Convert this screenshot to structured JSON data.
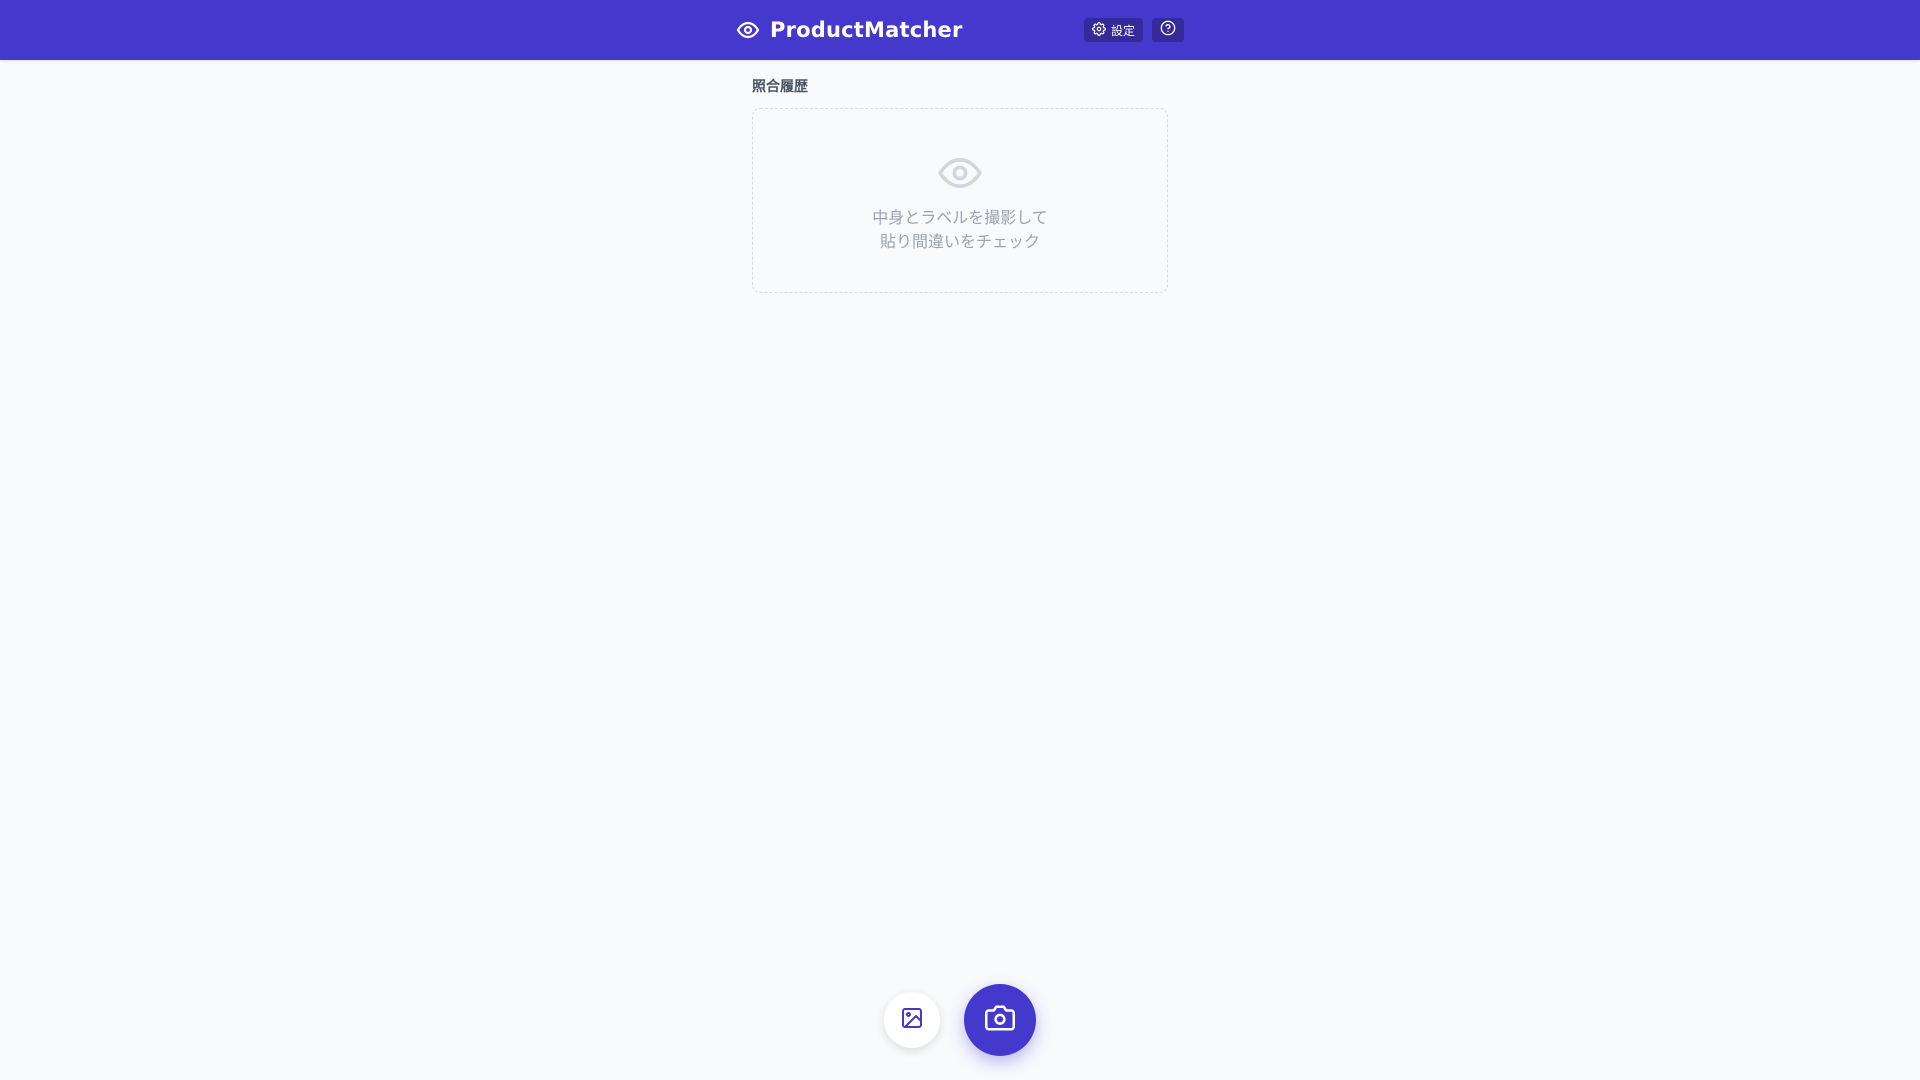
{
  "header": {
    "app_title": "ProductMatcher",
    "logo_icon": "eye-icon",
    "settings_label": "設定",
    "settings_icon": "gear-icon",
    "help_icon": "help-circle-icon",
    "background_color": "#4538cc"
  },
  "history": {
    "section_title": "照合履歴",
    "empty_state": {
      "icon": "eye-icon",
      "line1": "中身とラベルを撮影して",
      "line2": "貼り間違いをチェック"
    }
  },
  "actions": {
    "gallery_icon": "image-icon",
    "camera_icon": "camera-icon",
    "accent_color": "#4538cc"
  }
}
